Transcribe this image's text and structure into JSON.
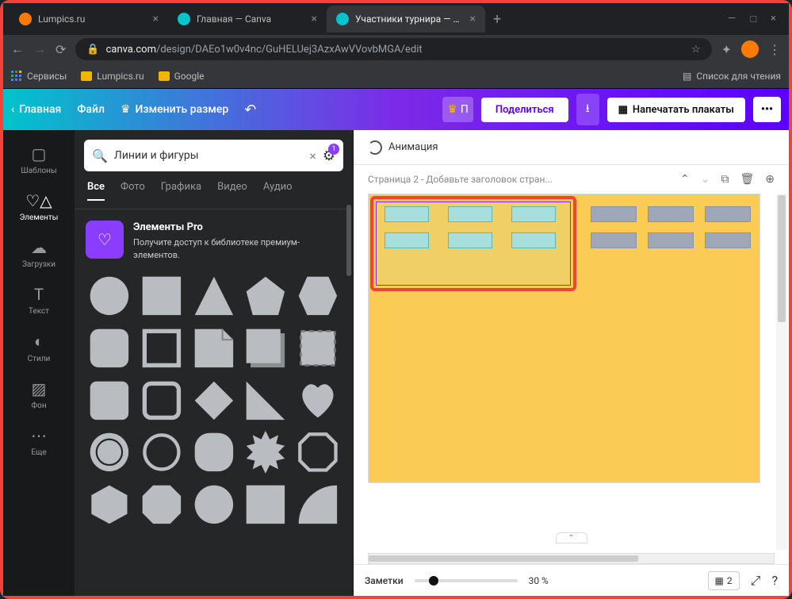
{
  "browser": {
    "tabs": [
      {
        "title": "Lumpics.ru",
        "favicon": "#ff7a00"
      },
      {
        "title": "Главная — Canva",
        "favicon": "#00c4cc"
      },
      {
        "title": "Участники турнира — Плакат",
        "favicon": "#00c4cc"
      }
    ],
    "url_domain": "canva.com",
    "url_path": "/design/DAEo1w0v4nc/GuHELUej3AzxAwVVovbMGA/edit",
    "bookmarks": {
      "services": "Сервисы",
      "lumpics": "Lumpics.ru",
      "google": "Google",
      "reading_list": "Список для чтения"
    }
  },
  "header": {
    "home": "Главная",
    "file": "Файл",
    "resize": "Изменить размер",
    "premium_short": "П",
    "share": "Поделиться",
    "print": "Напечатать плакаты",
    "more": "•••"
  },
  "rail": {
    "templates": "Шаблоны",
    "elements": "Элементы",
    "uploads": "Загрузки",
    "text": "Текст",
    "styles": "Стили",
    "background": "Фон",
    "more": "Еще"
  },
  "panel": {
    "search_value": "Линии и фигуры",
    "filter_count": "1",
    "tabs": {
      "all": "Все",
      "photo": "Фото",
      "graphics": "Графика",
      "video": "Видео",
      "audio": "Аудио"
    },
    "pro": {
      "title": "Элементы Pro",
      "desc": "Получите доступ к библиотеке премиум-элементов."
    }
  },
  "canvas": {
    "animation": "Анимация",
    "page_title": "Страница 2 - Добавьте заголовок стран...",
    "notes": "Заметки",
    "zoom": "30 %",
    "page_num": "2"
  }
}
